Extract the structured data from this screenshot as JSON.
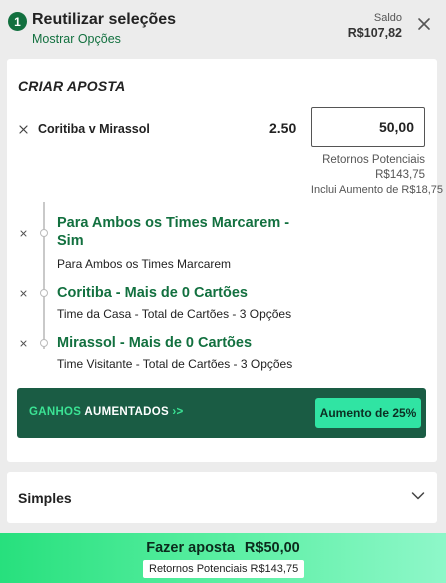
{
  "header": {
    "badge": "1",
    "title": "Reutilizar seleções",
    "show_options": "Mostrar Opções",
    "balance_label": "Saldo",
    "balance_value": "R$107,82"
  },
  "bet_builder": {
    "title": "CRIAR APOSTA",
    "match": "Coritiba v Mirassol",
    "odds": "2.50",
    "stake": "50,00",
    "potential_returns_label": "Retornos Potenciais",
    "potential_returns_value": "R$143,75",
    "boost_included": "Inclui Aumento de R$18,75",
    "legs": [
      {
        "title": "Para Ambos os Times Marcarem - Sim",
        "subtitle": "Para Ambos os Times Marcarem"
      },
      {
        "title": "Coritiba - Mais de 0 Cartões",
        "subtitle": "Time da Casa - Total de Cartões - 3 Opções"
      },
      {
        "title": "Mirassol - Mais de 0 Cartões",
        "subtitle": "Time Visitante - Total de Cartões - 3 Opções"
      }
    ],
    "boost_banner": {
      "label_green": "GANHOS",
      "label_white": "AUMENTADOS",
      "arrow": "›>",
      "pill": "Aumento de 25%"
    }
  },
  "bet_type": {
    "label": "Simples"
  },
  "place_bet": {
    "label": "Fazer aposta",
    "amount": "R$50,00",
    "returns": "Retornos Potenciais R$143,75"
  },
  "colors": {
    "brand_green": "#12703f",
    "boost_bg": "#1a5c44",
    "boost_pill": "#30e4a3",
    "cta_start": "#27e07d",
    "cta_end": "#8ef7c9"
  }
}
